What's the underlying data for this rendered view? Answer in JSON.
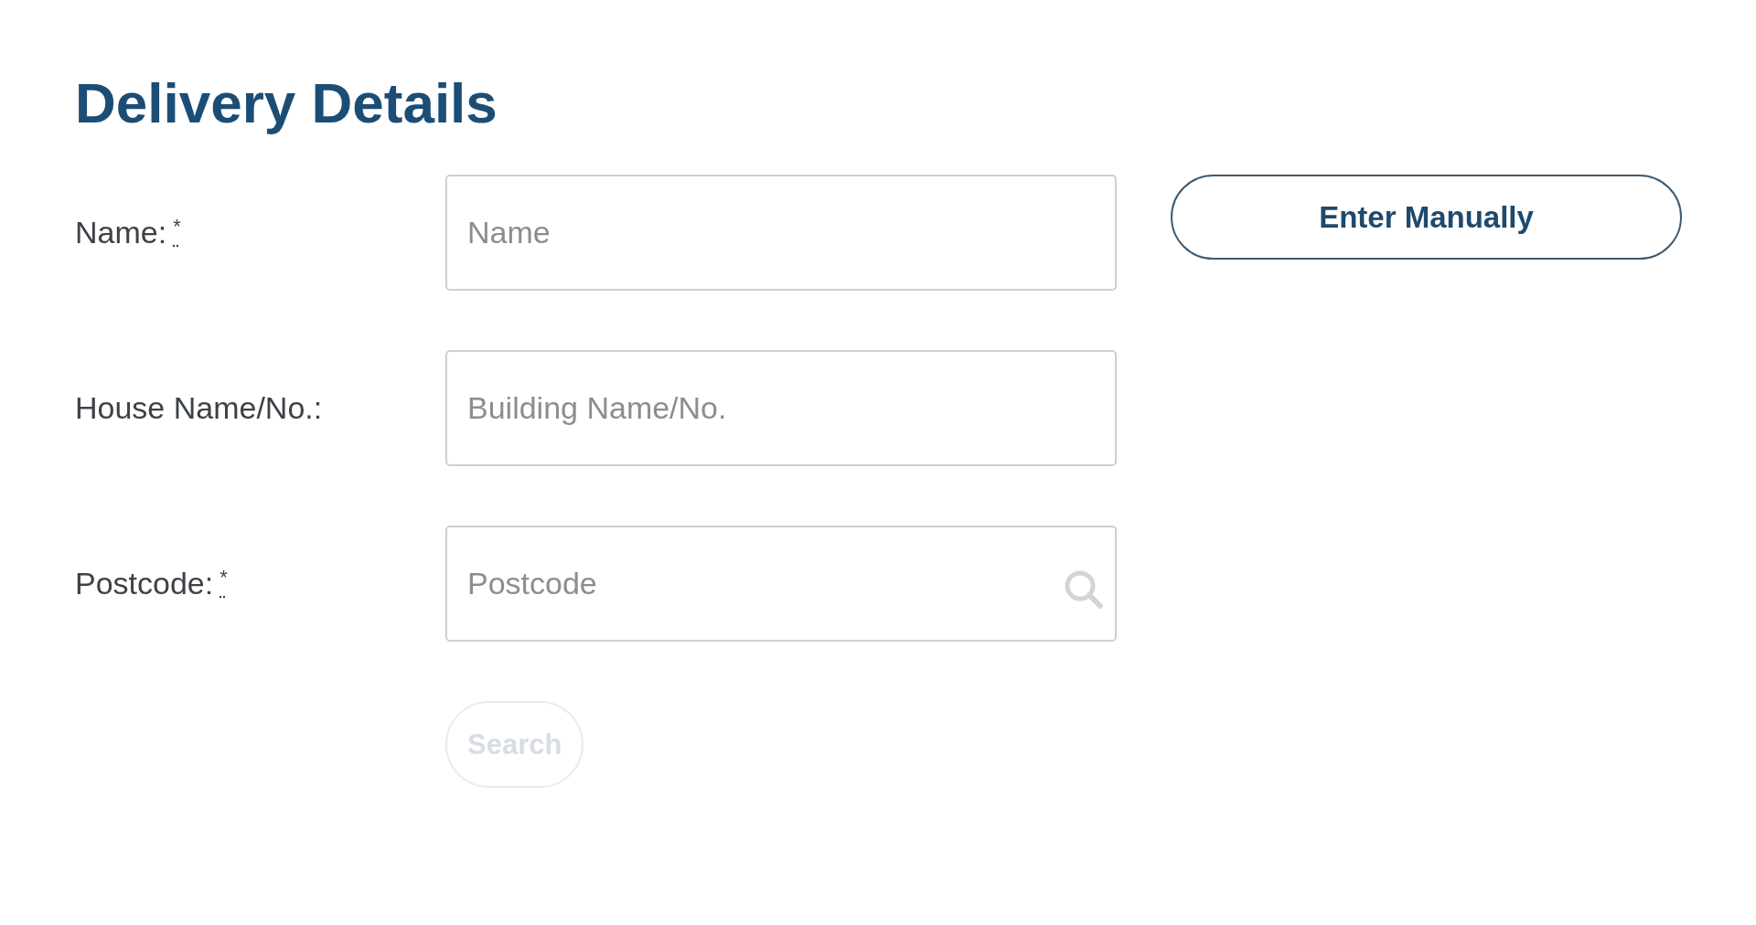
{
  "title": "Delivery Details",
  "fields": [
    {
      "label": "Name:",
      "required_mark": "*",
      "placeholder": "Name",
      "kind": "text"
    },
    {
      "label": "House Name/No.:",
      "placeholder": "Building Name/No.",
      "kind": "text"
    },
    {
      "label": "Postcode:",
      "required_mark": "*",
      "placeholder": "Postcode",
      "kind": "search"
    }
  ],
  "enter_manually_button": {
    "label": "Enter Manually"
  },
  "search_button": {
    "label": "Search",
    "disabled": true
  }
}
